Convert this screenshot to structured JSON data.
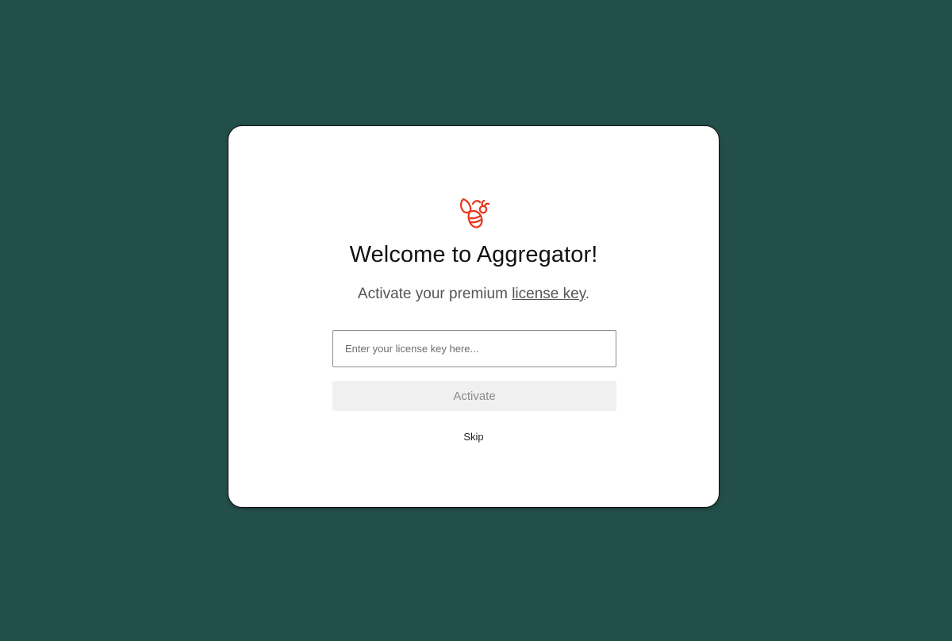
{
  "modal": {
    "logo_icon": "bee-icon",
    "accent_color": "#e8341c",
    "title": "Welcome to Aggregator!",
    "subtitle_prefix": "Activate your premium ",
    "subtitle_link": "license key",
    "subtitle_suffix": ".",
    "license_input": {
      "value": "",
      "placeholder": "Enter your license key here..."
    },
    "activate_label": "Activate",
    "skip_label": "Skip"
  }
}
